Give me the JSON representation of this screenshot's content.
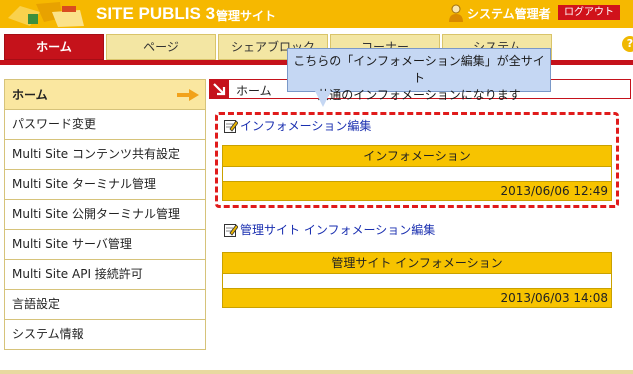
{
  "header": {
    "logo_text": "SITE PUBLIS 3",
    "site_title": "管理サイト",
    "user_name": "システム管理者",
    "logout_label": "ログアウト"
  },
  "nav": {
    "tabs": [
      {
        "label": "ホーム",
        "active": true
      },
      {
        "label": "ページ",
        "active": false
      },
      {
        "label": "シェアブロック",
        "active": false
      },
      {
        "label": "コーナー",
        "active": false
      },
      {
        "label": "システム",
        "active": false
      }
    ]
  },
  "callout": {
    "line1": "こちらの「インフォメーション編集」が全サイト",
    "line2": "共通のインフォメーションになります"
  },
  "sidebar": {
    "items": [
      {
        "label": "ホーム"
      },
      {
        "label": "パスワード変更"
      },
      {
        "label": "Multi Site コンテンツ共有設定"
      },
      {
        "label": "Multi Site ターミナル管理"
      },
      {
        "label": "Multi Site 公開ターミナル管理"
      },
      {
        "label": "Multi Site サーバ管理"
      },
      {
        "label": "Multi Site API 接続許可"
      },
      {
        "label": "言語設定"
      },
      {
        "label": "システム情報"
      }
    ]
  },
  "breadcrumb": {
    "current": "ホーム"
  },
  "info_section": {
    "edit_link": "インフォメーション編集",
    "title": "インフォメーション",
    "date": "2013/06/06 12:49"
  },
  "admin_info_section": {
    "edit_link": "管理サイト インフォメーション編集",
    "title": "管理サイト インフォメーション",
    "date": "2013/06/03 14:08"
  },
  "colors": {
    "header_yellow": "#f6b800",
    "nav_red": "#c5121b",
    "info_yellow": "#f7c300",
    "dashed_red": "#e01b1b",
    "callout_blue": "#c5d7f3"
  }
}
